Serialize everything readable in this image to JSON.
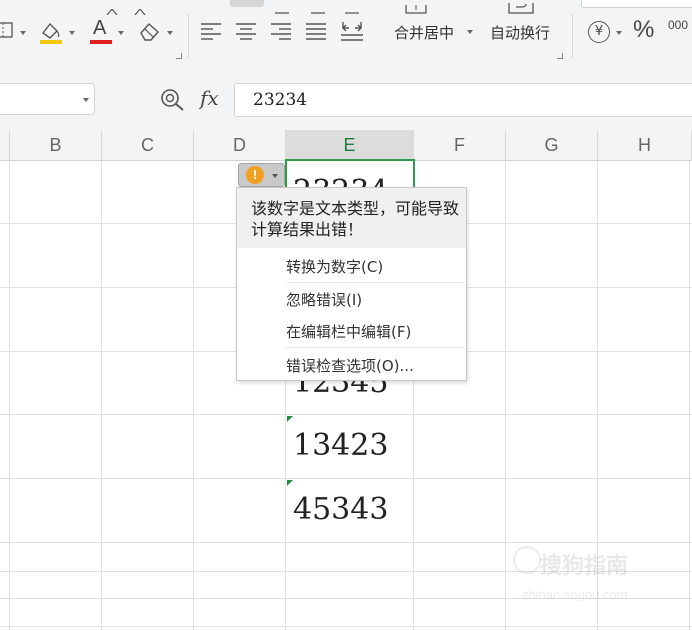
{
  "ribbon": {
    "font_color_glyph": "A",
    "merge_center_label": "合并居中",
    "wrap_text_label": "自动换行",
    "percent_glyph": "%",
    "currency_glyph": "¥",
    "thousands_glyph": "000",
    "icons": [
      "border-icon",
      "fill-color-icon",
      "font-color-icon",
      "eraser-icon",
      "align-left-icon",
      "align-center-icon",
      "align-right-icon",
      "justify-icon",
      "distributed-icon",
      "merge-icon",
      "wrap-icon",
      "currency-icon"
    ],
    "accent_colors": {
      "fill": "#f2c811",
      "font": "#e02020"
    }
  },
  "formula_bar": {
    "fx_label": "fx",
    "value": "23234"
  },
  "columns": [
    "B",
    "C",
    "D",
    "E",
    "F",
    "G",
    "H"
  ],
  "selected_column": "E",
  "cells": {
    "e_row1": "23234",
    "e_row4": "12345",
    "e_row5": "13423",
    "e_row6": "45343"
  },
  "error_menu": {
    "message": "该数字是文本类型，可能导致计算结果出错！",
    "items": [
      "转换为数字(C)",
      "忽略错误(I)",
      "在编辑栏中编辑(F)",
      "错误检查选项(O)..."
    ]
  },
  "smart_tag": {
    "glyph": "!"
  },
  "colors": {
    "selection_green": "#2e9d4a",
    "warning_orange": "#f0a020",
    "error_triangle": "#1f8f3a"
  },
  "watermark": {
    "text": "搜狗指南",
    "url": "zhinan.sogou.com"
  }
}
